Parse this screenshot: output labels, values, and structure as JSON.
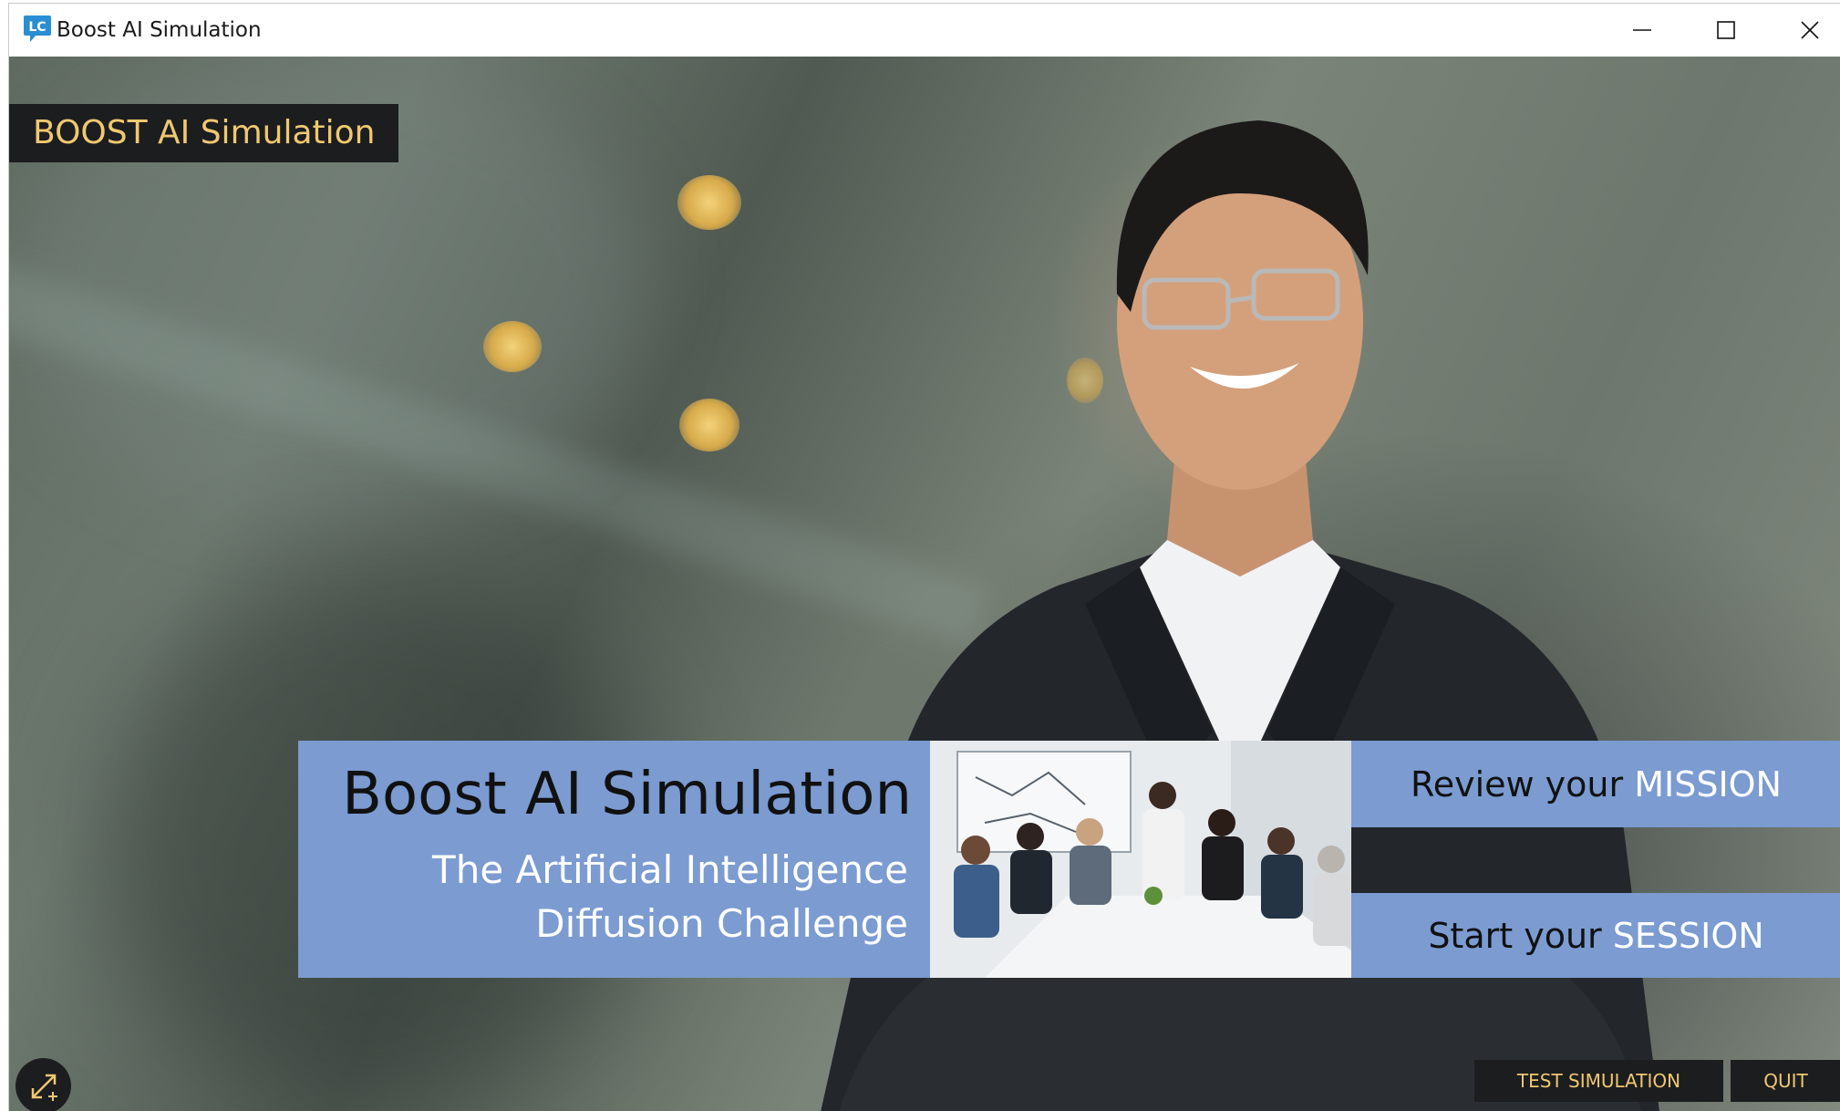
{
  "window": {
    "title": "Boost AI Simulation",
    "icon": "app-chat-bubble-icon",
    "controls": [
      "minimize-icon",
      "maximize-icon",
      "close-icon"
    ]
  },
  "header": {
    "badge": "BOOST AI Simulation"
  },
  "banner": {
    "title": "Boost AI Simulation",
    "subtitle_line1": "The Artificial Intelligence",
    "subtitle_line2": "Diffusion Challenge",
    "photo_icon": "team-meeting-photo"
  },
  "actions": {
    "mission_prefix": "Review your ",
    "mission_highlight": "MISSION",
    "session_prefix": "Start your ",
    "session_highlight": "SESSION"
  },
  "footer": {
    "fullscreen_icon": "expand-icon",
    "test_label": "TEST SIMULATION",
    "quit_label": "QUIT"
  },
  "colors": {
    "accent_blue": "#7b9bd1",
    "gold_text": "#f0c870",
    "dark_panel": "#1c1d1f"
  }
}
